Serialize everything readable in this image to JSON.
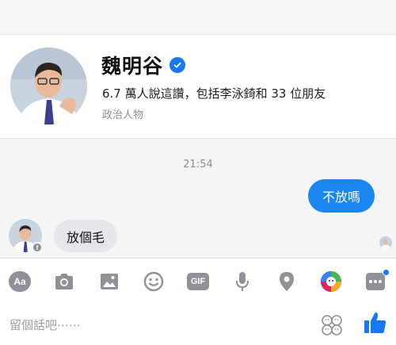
{
  "profile": {
    "name": "魏明谷",
    "likes_text": "6.7 萬人說這讚，包括李泳錡和 33 位朋友",
    "category": "政治人物"
  },
  "conversation": {
    "timestamp": "21:54",
    "messages": [
      {
        "sender": "me",
        "text": "不放嗎"
      },
      {
        "sender": "page",
        "text": "放個毛"
      }
    ]
  },
  "composer": {
    "placeholder": "留個話吧⋯⋯",
    "aa_label": "Aa",
    "gif_label": "GIF"
  },
  "colors": {
    "accent": "#1877f2",
    "outgoing_bubble": "#1b86f0",
    "incoming_bubble": "#e4e6eb",
    "icon_gray": "#8e9197"
  }
}
